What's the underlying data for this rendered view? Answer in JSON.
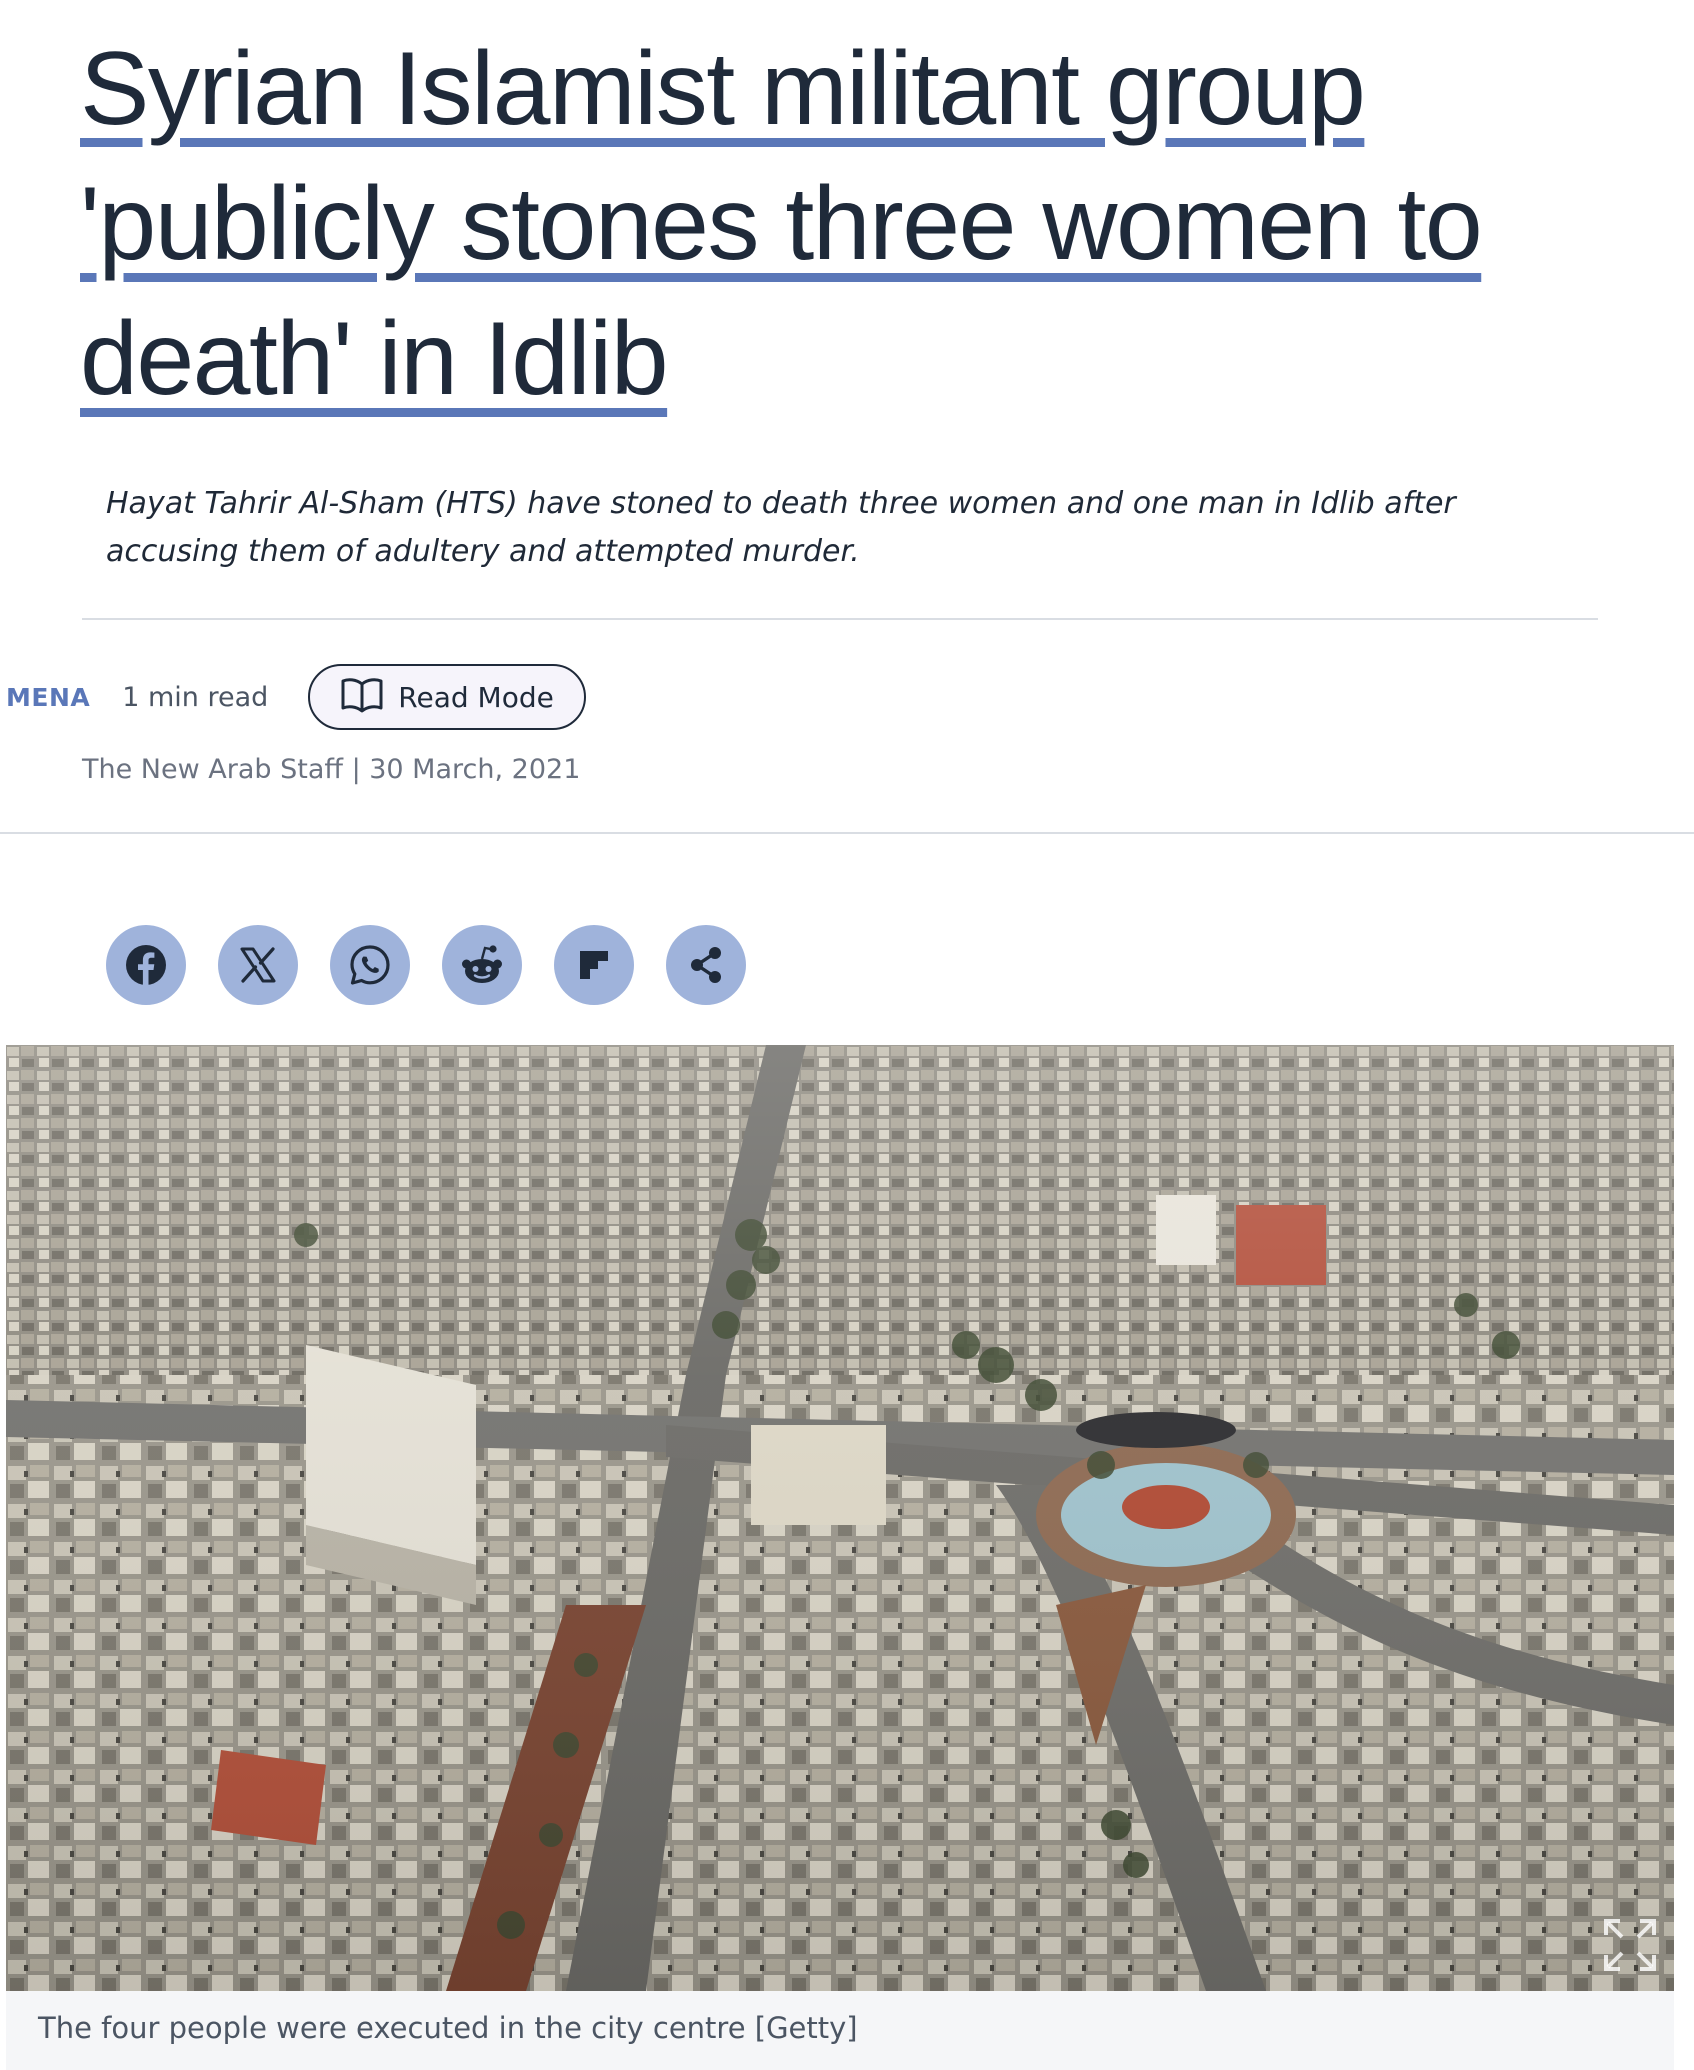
{
  "article": {
    "headline": "Syrian Islamist militant group 'publicly stones three women to death' in Idlib",
    "standfirst": "Hayat Tahrir Al-Sham (HTS) have stoned to death three women and one man in Idlib after accusing them of adultery and attempted murder.",
    "category": "MENA",
    "read_time": "1 min read",
    "read_mode_label": "Read Mode",
    "byline": "The New Arab Staff | 30 March, 2021",
    "image_caption": "The four people were executed in the city centre [Getty]"
  },
  "share": {
    "buttons": [
      {
        "icon": "facebook-icon"
      },
      {
        "icon": "x-icon"
      },
      {
        "icon": "whatsapp-icon"
      },
      {
        "icon": "reddit-icon"
      },
      {
        "icon": "flipboard-icon"
      },
      {
        "icon": "share-icon"
      }
    ]
  },
  "colors": {
    "accent": "#5a77b8",
    "share_button_bg": "#9fb3db",
    "headline_text": "#1f2a3a",
    "muted_text": "#6b7280",
    "divider": "#d9dde3",
    "caption_bg": "#f5f6f8"
  }
}
